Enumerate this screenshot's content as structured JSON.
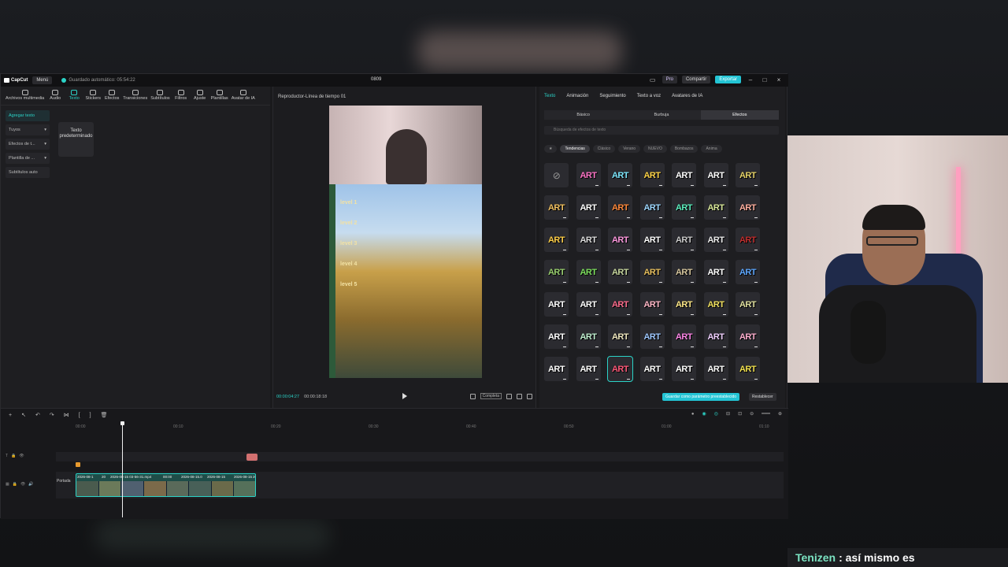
{
  "window": {
    "app_name": "CapCut",
    "menu_label": "Menú",
    "autosave_text": "Guardado automático: 05:54:22",
    "project_title": "0809",
    "pro_label": "Pro",
    "share_label": "Compartir",
    "export_label": "Exportar"
  },
  "toolbar": {
    "items": [
      {
        "label": "Archivos multimedia"
      },
      {
        "label": "Audio"
      },
      {
        "label": "Texto"
      },
      {
        "label": "Stickers"
      },
      {
        "label": "Efectos"
      },
      {
        "label": "Transiciones"
      },
      {
        "label": "Subtítulos"
      },
      {
        "label": "Filtros"
      },
      {
        "label": "Ajuste"
      },
      {
        "label": "Plantillas"
      },
      {
        "label": "Avatar de IA"
      }
    ]
  },
  "side_menu": {
    "items": [
      {
        "label": "Agregar texto"
      },
      {
        "label": "Tuyos"
      },
      {
        "label": "Efectos de t..."
      },
      {
        "label": "Plantilla de ..."
      },
      {
        "label": "Subtítulos auto"
      }
    ],
    "preset_card": "Texto predeterminado"
  },
  "player": {
    "title": "Reproductor-Línea de tiempo 01",
    "current_time": "00:00:04:27",
    "total_time": "00:00:18:18",
    "ratio_label": "Completa",
    "levels": [
      "level 1",
      "level 2",
      "level 3",
      "level 4",
      "level 5"
    ]
  },
  "right_panel": {
    "tabs": [
      {
        "label": "Texto"
      },
      {
        "label": "Animación"
      },
      {
        "label": "Seguimiento"
      },
      {
        "label": "Texto a voz"
      },
      {
        "label": "Avatares de IA"
      }
    ],
    "subtabs": [
      {
        "label": "Básico"
      },
      {
        "label": "Burbuja"
      },
      {
        "label": "Efectos"
      }
    ],
    "search_placeholder": "Búsqueda de efectos de texto",
    "chips": [
      {
        "label": "★"
      },
      {
        "label": "Tendencias"
      },
      {
        "label": "Clásico"
      },
      {
        "label": "Verano"
      },
      {
        "label": "NUEVO"
      },
      {
        "label": "Bombazos"
      },
      {
        "label": "Anima"
      }
    ],
    "tile_text": "ART",
    "save_preset_label": "Guardar como parámetro preestablecido",
    "reset_label": "Restablecer"
  },
  "timeline": {
    "ruler": [
      "00:00",
      "00:10",
      "00:20",
      "00:30",
      "00:40",
      "00:50",
      "01:00",
      "01:10"
    ],
    "cover_label": "Portada",
    "clip_labels": [
      "2026-08-1",
      "20",
      "2026-08-15 03-56-31.mp4",
      "00:00",
      "2026-08-15.0",
      "2026-08-15",
      "2026-08-15",
      "2026-08-15"
    ]
  },
  "chat": {
    "user": "Tenizen",
    "message": "así mismo es"
  },
  "colors": {
    "accent": "#2bd3c7",
    "export": "#23c4d4"
  }
}
